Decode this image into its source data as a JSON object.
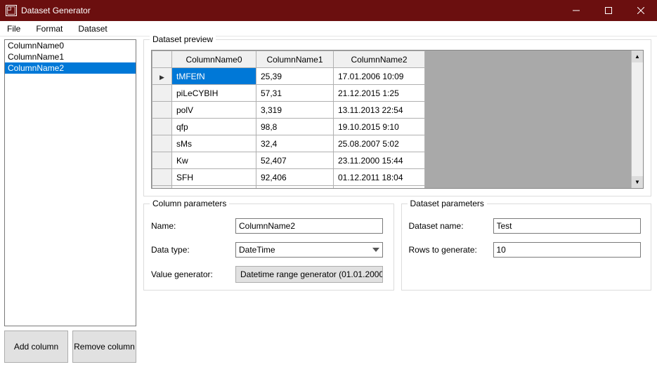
{
  "window": {
    "title": "Dataset Generator"
  },
  "menu": {
    "file": "File",
    "format": "Format",
    "dataset": "Dataset"
  },
  "columns": {
    "items": [
      {
        "name": "ColumnName0"
      },
      {
        "name": "ColumnName1"
      },
      {
        "name": "ColumnName2"
      }
    ],
    "selected_index": 2
  },
  "side_buttons": {
    "add": "Add column",
    "remove": "Remove column"
  },
  "preview": {
    "legend": "Dataset preview",
    "headers": [
      "ColumnName0",
      "ColumnName1",
      "ColumnName2"
    ],
    "rows": [
      {
        "c0": "tMFEfN",
        "c1": "25,39",
        "c2": "17.01.2006 10:09"
      },
      {
        "c0": "piLeCYBIH",
        "c1": "57,31",
        "c2": "21.12.2015 1:25"
      },
      {
        "c0": "polV",
        "c1": "3,319",
        "c2": "13.11.2013 22:54"
      },
      {
        "c0": "qfp",
        "c1": "98,8",
        "c2": "19.10.2015 9:10"
      },
      {
        "c0": "sMs",
        "c1": "32,4",
        "c2": "25.08.2007 5:02"
      },
      {
        "c0": "Kw",
        "c1": "52,407",
        "c2": "23.11.2000 15:44"
      },
      {
        "c0": "SFH",
        "c1": "92,406",
        "c2": "01.12.2011 18:04"
      }
    ],
    "selected_row": 0
  },
  "col_params": {
    "legend": "Column parameters",
    "name_label": "Name:",
    "name_value": "ColumnName2",
    "type_label": "Data type:",
    "type_value": "DateTime",
    "gen_label": "Value generator:",
    "gen_value": "Datetime range generator (01.01.2000"
  },
  "ds_params": {
    "legend": "Dataset parameters",
    "name_label": "Dataset name:",
    "name_value": "Test",
    "rows_label": "Rows to generate:",
    "rows_value": "10"
  }
}
